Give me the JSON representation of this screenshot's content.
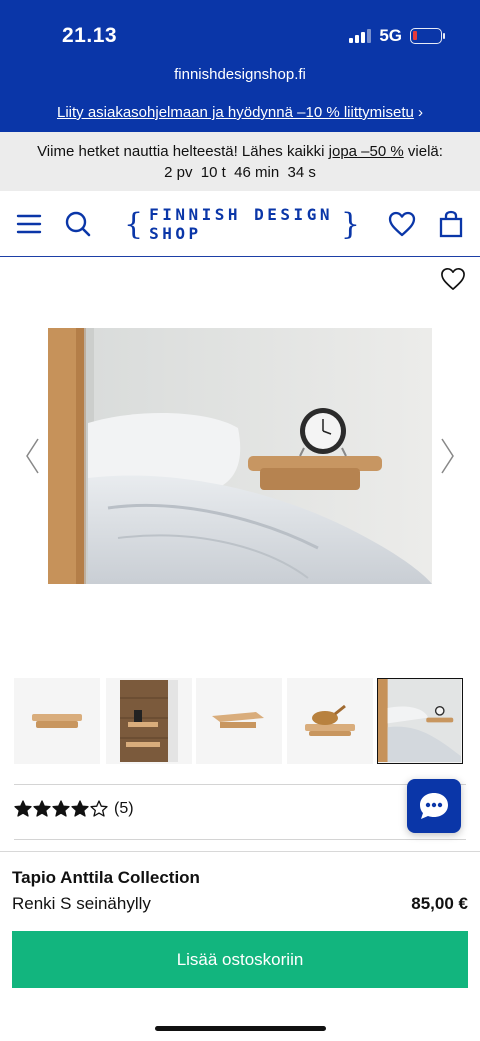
{
  "status_bar": {
    "time": "21.13",
    "network": "5G"
  },
  "browser": {
    "url": "finnishdesignshop.fi"
  },
  "promo": {
    "link_text": "Liity asiakasohjelmaan ja hyödynnä –10 % liittymisetu",
    "arrow": "›"
  },
  "sale_banner": {
    "text_before": "Viime hetket nauttia helteestä! Lähes kaikki",
    "link_text": "jopa –50 %",
    "text_after": "vielä:",
    "countdown": "2 pv  10 t  46 min  34 s"
  },
  "header": {
    "logo_text": "FINNISH DESIGN SHOP",
    "logo_left_brace": "{",
    "logo_right_brace": "}"
  },
  "product": {
    "rating_count": "(5)",
    "rating": 4,
    "rating_max": 5,
    "brand": "Tapio Anttila Collection",
    "name": "Renki S seinähylly",
    "price": "85,00 €",
    "add_to_cart_label": "Lisää ostoskoriin"
  },
  "gallery": {
    "thumbnail_count": 5,
    "active_thumbnail": 5
  },
  "colors": {
    "brand_blue": "#0a36a8",
    "cta_green": "#12b57e"
  }
}
